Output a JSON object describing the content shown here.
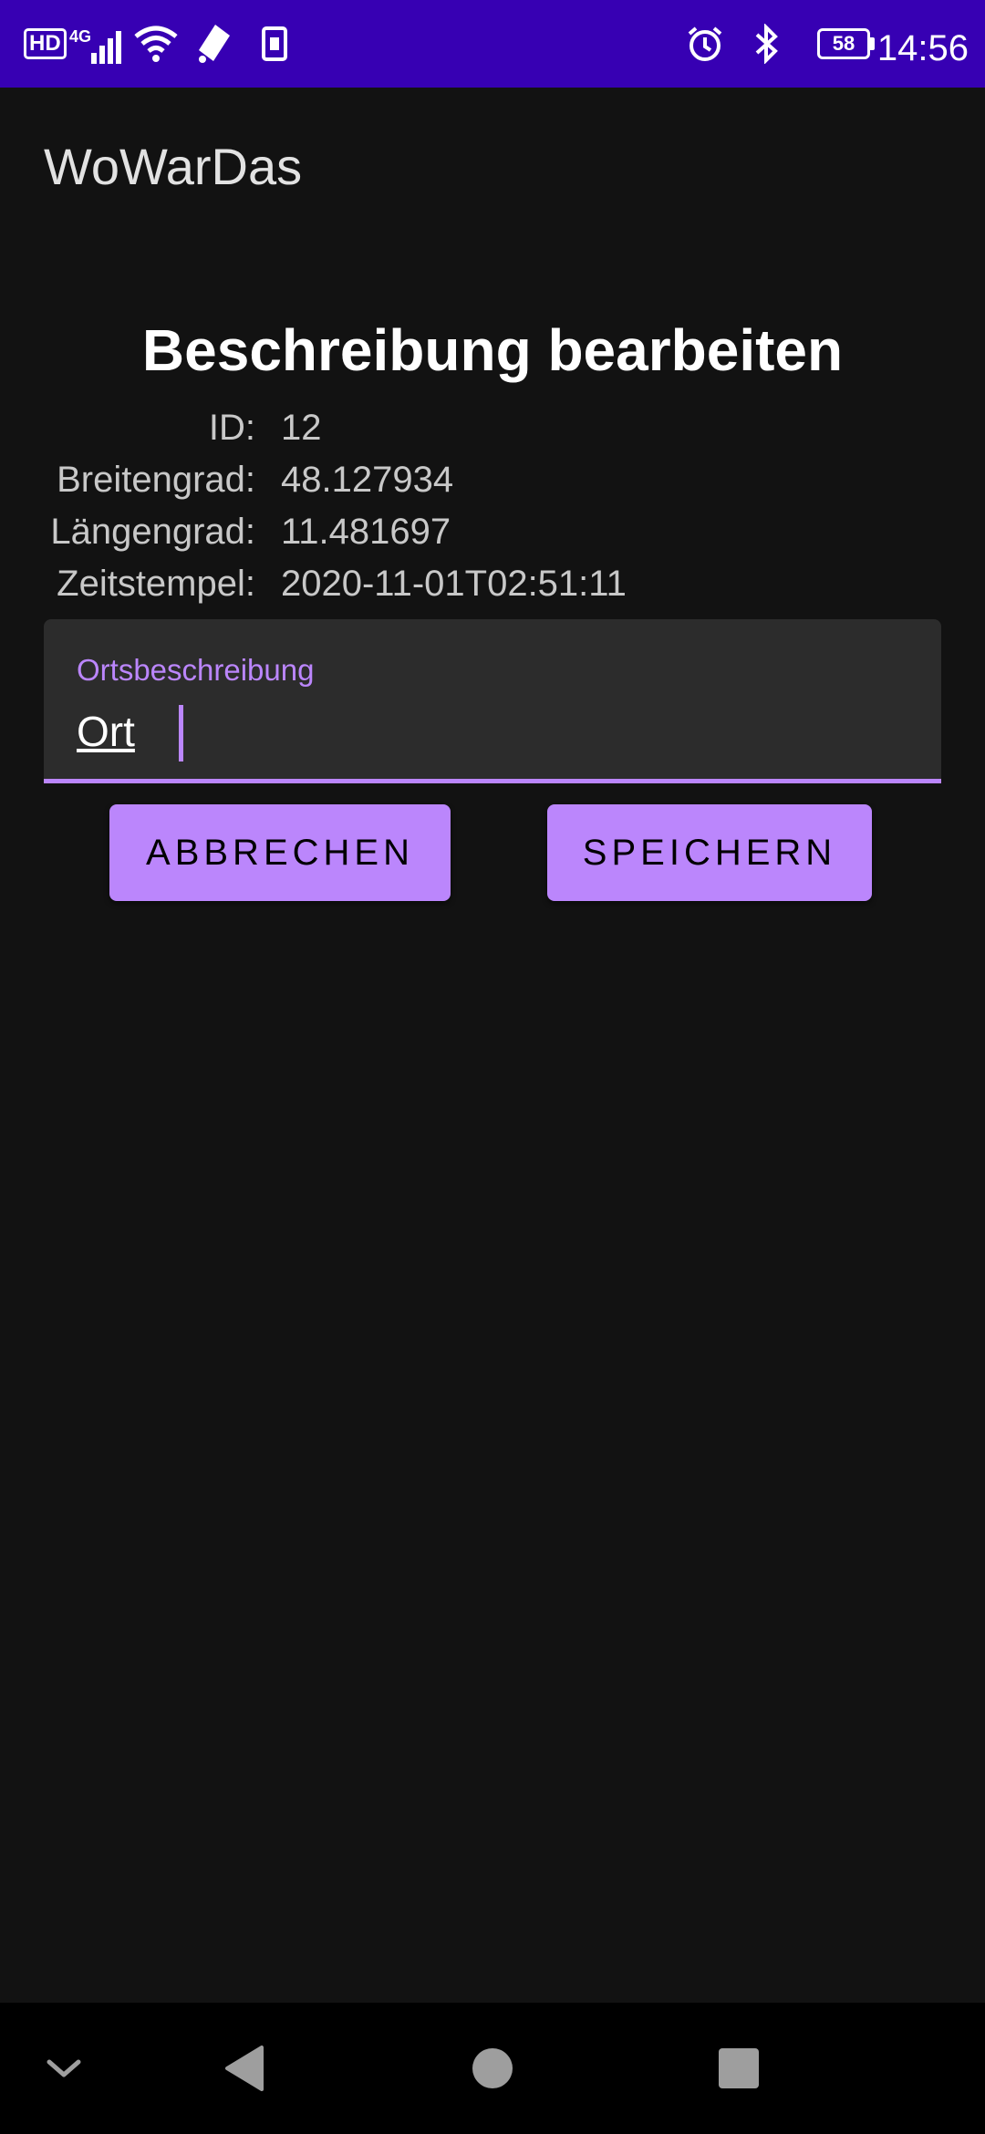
{
  "status_bar": {
    "hd_label": "HD",
    "network_label": "4G",
    "battery_level": "58",
    "time": "14:56",
    "icons": [
      "hd-icon",
      "signal-icon",
      "wifi-icon",
      "location-icon",
      "sim-icon",
      "alarm-icon",
      "bluetooth-icon",
      "battery-icon"
    ]
  },
  "app_bar": {
    "title": "WoWarDas"
  },
  "main": {
    "heading": "Beschreibung bearbeiten",
    "info": {
      "id_label": "ID:",
      "id_value": "12",
      "lat_label": "Breitengrad:",
      "lat_value": "48.127934",
      "lon_label": "Längengrad:",
      "lon_value": "11.481697",
      "time_label": "Zeitstempel:",
      "time_value": "2020-11-01T02:51:11"
    },
    "description_field": {
      "label": "Ortsbeschreibung",
      "value": "Ort"
    },
    "buttons": {
      "cancel": "ABBRECHEN",
      "save": "SPEICHERN"
    }
  },
  "colors": {
    "status_bar": "#3700b3",
    "accent": "#bb86fc",
    "background": "#121212",
    "field_background": "#2c2c2c"
  },
  "nav_bar": {
    "icons": [
      "chevron-down-icon",
      "back-icon",
      "home-icon",
      "recents-icon"
    ]
  }
}
